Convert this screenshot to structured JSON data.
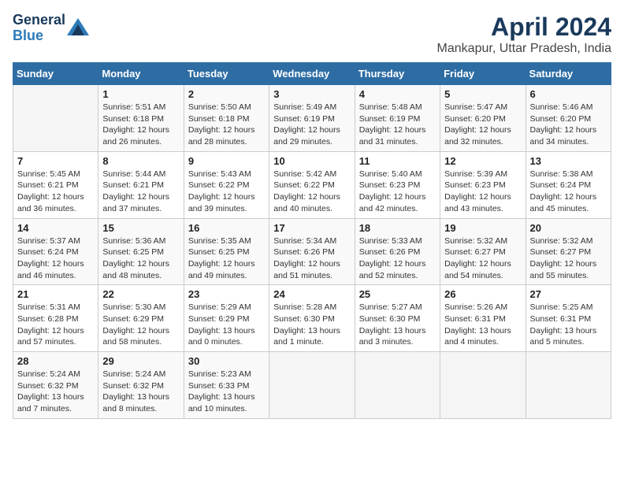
{
  "header": {
    "logo_line1": "General",
    "logo_line2": "Blue",
    "title": "April 2024",
    "subtitle": "Mankapur, Uttar Pradesh, India"
  },
  "days_of_week": [
    "Sunday",
    "Monday",
    "Tuesday",
    "Wednesday",
    "Thursday",
    "Friday",
    "Saturday"
  ],
  "weeks": [
    [
      {
        "day": "",
        "detail": ""
      },
      {
        "day": "1",
        "detail": "Sunrise: 5:51 AM\nSunset: 6:18 PM\nDaylight: 12 hours\nand 26 minutes."
      },
      {
        "day": "2",
        "detail": "Sunrise: 5:50 AM\nSunset: 6:18 PM\nDaylight: 12 hours\nand 28 minutes."
      },
      {
        "day": "3",
        "detail": "Sunrise: 5:49 AM\nSunset: 6:19 PM\nDaylight: 12 hours\nand 29 minutes."
      },
      {
        "day": "4",
        "detail": "Sunrise: 5:48 AM\nSunset: 6:19 PM\nDaylight: 12 hours\nand 31 minutes."
      },
      {
        "day": "5",
        "detail": "Sunrise: 5:47 AM\nSunset: 6:20 PM\nDaylight: 12 hours\nand 32 minutes."
      },
      {
        "day": "6",
        "detail": "Sunrise: 5:46 AM\nSunset: 6:20 PM\nDaylight: 12 hours\nand 34 minutes."
      }
    ],
    [
      {
        "day": "7",
        "detail": "Sunrise: 5:45 AM\nSunset: 6:21 PM\nDaylight: 12 hours\nand 36 minutes."
      },
      {
        "day": "8",
        "detail": "Sunrise: 5:44 AM\nSunset: 6:21 PM\nDaylight: 12 hours\nand 37 minutes."
      },
      {
        "day": "9",
        "detail": "Sunrise: 5:43 AM\nSunset: 6:22 PM\nDaylight: 12 hours\nand 39 minutes."
      },
      {
        "day": "10",
        "detail": "Sunrise: 5:42 AM\nSunset: 6:22 PM\nDaylight: 12 hours\nand 40 minutes."
      },
      {
        "day": "11",
        "detail": "Sunrise: 5:40 AM\nSunset: 6:23 PM\nDaylight: 12 hours\nand 42 minutes."
      },
      {
        "day": "12",
        "detail": "Sunrise: 5:39 AM\nSunset: 6:23 PM\nDaylight: 12 hours\nand 43 minutes."
      },
      {
        "day": "13",
        "detail": "Sunrise: 5:38 AM\nSunset: 6:24 PM\nDaylight: 12 hours\nand 45 minutes."
      }
    ],
    [
      {
        "day": "14",
        "detail": "Sunrise: 5:37 AM\nSunset: 6:24 PM\nDaylight: 12 hours\nand 46 minutes."
      },
      {
        "day": "15",
        "detail": "Sunrise: 5:36 AM\nSunset: 6:25 PM\nDaylight: 12 hours\nand 48 minutes."
      },
      {
        "day": "16",
        "detail": "Sunrise: 5:35 AM\nSunset: 6:25 PM\nDaylight: 12 hours\nand 49 minutes."
      },
      {
        "day": "17",
        "detail": "Sunrise: 5:34 AM\nSunset: 6:26 PM\nDaylight: 12 hours\nand 51 minutes."
      },
      {
        "day": "18",
        "detail": "Sunrise: 5:33 AM\nSunset: 6:26 PM\nDaylight: 12 hours\nand 52 minutes."
      },
      {
        "day": "19",
        "detail": "Sunrise: 5:32 AM\nSunset: 6:27 PM\nDaylight: 12 hours\nand 54 minutes."
      },
      {
        "day": "20",
        "detail": "Sunrise: 5:32 AM\nSunset: 6:27 PM\nDaylight: 12 hours\nand 55 minutes."
      }
    ],
    [
      {
        "day": "21",
        "detail": "Sunrise: 5:31 AM\nSunset: 6:28 PM\nDaylight: 12 hours\nand 57 minutes."
      },
      {
        "day": "22",
        "detail": "Sunrise: 5:30 AM\nSunset: 6:29 PM\nDaylight: 12 hours\nand 58 minutes."
      },
      {
        "day": "23",
        "detail": "Sunrise: 5:29 AM\nSunset: 6:29 PM\nDaylight: 13 hours\nand 0 minutes."
      },
      {
        "day": "24",
        "detail": "Sunrise: 5:28 AM\nSunset: 6:30 PM\nDaylight: 13 hours\nand 1 minute."
      },
      {
        "day": "25",
        "detail": "Sunrise: 5:27 AM\nSunset: 6:30 PM\nDaylight: 13 hours\nand 3 minutes."
      },
      {
        "day": "26",
        "detail": "Sunrise: 5:26 AM\nSunset: 6:31 PM\nDaylight: 13 hours\nand 4 minutes."
      },
      {
        "day": "27",
        "detail": "Sunrise: 5:25 AM\nSunset: 6:31 PM\nDaylight: 13 hours\nand 5 minutes."
      }
    ],
    [
      {
        "day": "28",
        "detail": "Sunrise: 5:24 AM\nSunset: 6:32 PM\nDaylight: 13 hours\nand 7 minutes."
      },
      {
        "day": "29",
        "detail": "Sunrise: 5:24 AM\nSunset: 6:32 PM\nDaylight: 13 hours\nand 8 minutes."
      },
      {
        "day": "30",
        "detail": "Sunrise: 5:23 AM\nSunset: 6:33 PM\nDaylight: 13 hours\nand 10 minutes."
      },
      {
        "day": "",
        "detail": ""
      },
      {
        "day": "",
        "detail": ""
      },
      {
        "day": "",
        "detail": ""
      },
      {
        "day": "",
        "detail": ""
      }
    ]
  ]
}
